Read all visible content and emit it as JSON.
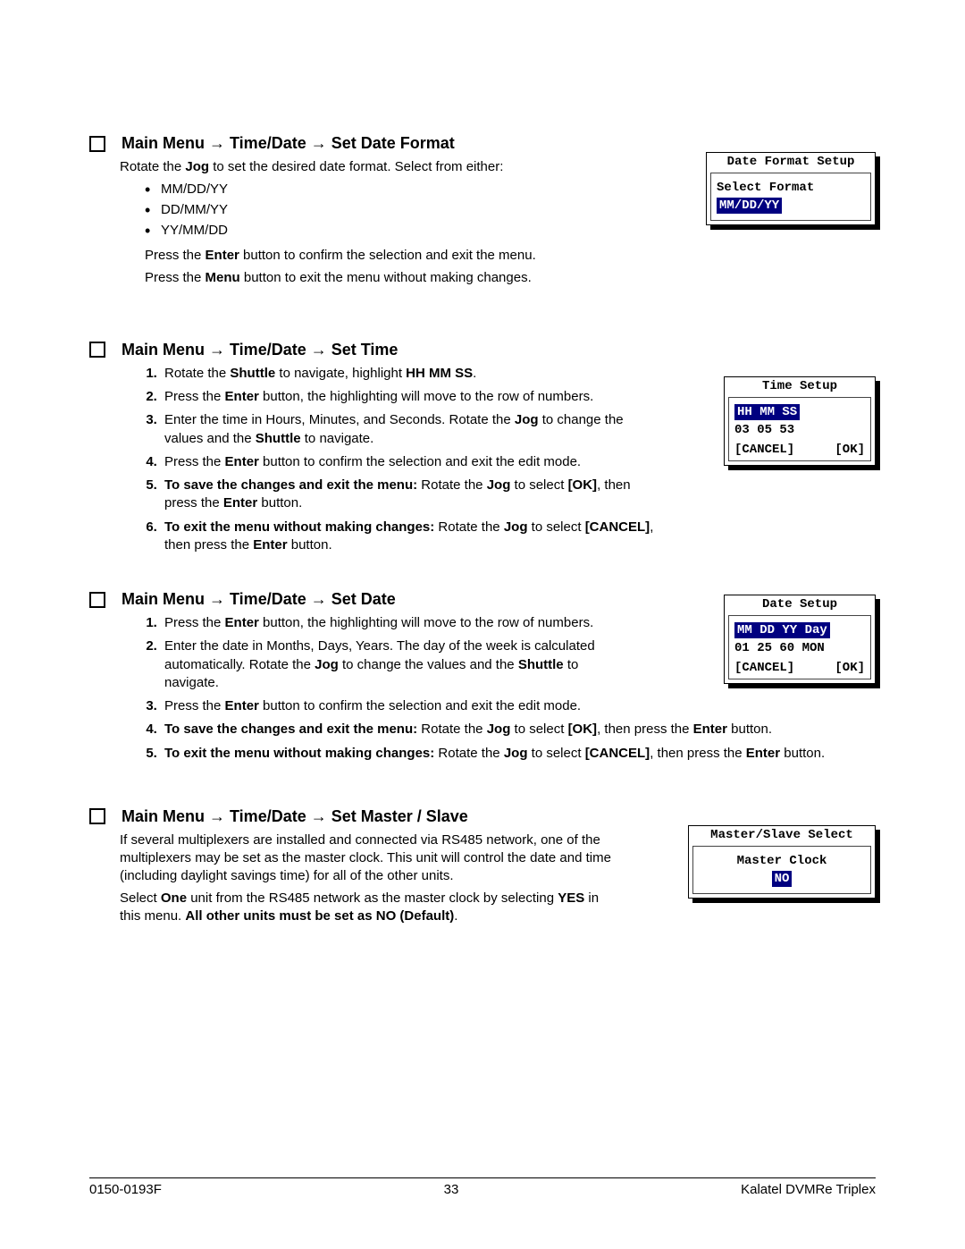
{
  "s1": {
    "heading_prefix": "Main Menu",
    "heading_mid": "Time/Date",
    "heading_end": "Set Date Format",
    "intro_a": "Rotate the ",
    "intro_b": "Jog",
    "intro_c": " to set the desired date format.  Select from either:",
    "opts": [
      "MM/DD/YY",
      "DD/MM/YY",
      "YY/MM/DD"
    ],
    "p1a": "Press the ",
    "p1b": "Enter",
    "p1c": " button to confirm the selection and exit the menu.",
    "p2a": "Press the ",
    "p2b": "Menu",
    "p2c": " button to exit the menu without making changes.",
    "ui": {
      "title": "Date Format Setup",
      "line1": "Select Format",
      "hl": "MM/DD/YY"
    }
  },
  "s2": {
    "heading_prefix": "Main Menu",
    "heading_mid": "Time/Date",
    "heading_end": "Set Time",
    "st1a": "Rotate the ",
    "st1b": "Shuttle",
    "st1c": " to navigate, highlight ",
    "st1d": "HH MM SS",
    "st1e": ".",
    "st2a": "Press the ",
    "st2b": "Enter",
    "st2c": " button, the highlighting will move to the row of numbers.",
    "st3a": "Enter the time in Hours, Minutes, and Seconds.  Rotate the ",
    "st3b": "Jog",
    "st3c": " to change the values and the ",
    "st3d": "Shuttle",
    "st3e": " to navigate.",
    "st4a": "Press the ",
    "st4b": "Enter",
    "st4c": " button to confirm the selection and exit the edit mode.",
    "st5a": "To save the changes and exit the menu:",
    "st5b": "  Rotate the ",
    "st5c": "Jog",
    "st5d": " to select ",
    "st5e": "[OK]",
    "st5f": ", then press the ",
    "st5g": "Enter",
    "st5h": " button.",
    "st6a": "To exit the menu without making changes:",
    "st6b": "  Rotate the ",
    "st6c": "Jog",
    "st6d": " to select ",
    "st6e": "[CANCEL]",
    "st6f": ", then press the ",
    "st6g": "Enter",
    "st6h": " button.",
    "ui": {
      "title": "Time Setup",
      "hl": "HH MM SS",
      "val": "03 05 53",
      "cancel": "[CANCEL]",
      "ok": "[OK]"
    }
  },
  "s3": {
    "heading_prefix": "Main Menu",
    "heading_mid": "Time/Date",
    "heading_end": "Set Date",
    "st1a": "Press the ",
    "st1b": "Enter",
    "st1c": " button, the highlighting will move to the row of numbers.",
    "st2a": "Enter the date in Months, Days, Years. The day of the week is calculated automatically. Rotate the ",
    "st2b": "Jog",
    "st2c": " to change the values and the ",
    "st2d": "Shuttle",
    "st2e": " to navigate.",
    "st3a": "Press the ",
    "st3b": "Enter",
    "st3c": " button to confirm the selection and exit the edit mode.",
    "st4a": "To save the changes and exit the menu:",
    "st4b": "  Rotate the ",
    "st4c": "Jog",
    "st4d": " to select ",
    "st4e": "[OK]",
    "st4f": ", then press the ",
    "st4g": "Enter",
    "st4h": " button.",
    "st5a": "To exit the menu without making changes:",
    "st5b": "  Rotate the ",
    "st5c": "Jog",
    "st5d": " to select ",
    "st5e": "[CANCEL]",
    "st5f": ", then press the ",
    "st5g": "Enter",
    "st5h": " button.",
    "ui": {
      "title": "Date Setup",
      "hl": "MM DD YY Day",
      "val": "01 25 60 MON",
      "cancel": "[CANCEL]",
      "ok": "[OK]"
    }
  },
  "s4": {
    "heading_prefix": "Main Menu",
    "heading_mid": "Time/Date",
    "heading_end": "Set Master / Slave",
    "p1": "If several multiplexers are installed and connected via RS485 network, one of the multiplexers may be set as the master clock.  This unit will control the date and time (including daylight savings time) for all of the other units.",
    "p2a": "Select ",
    "p2b": "One",
    "p2c": " unit from the RS485 network as the master clock by selecting ",
    "p2d": "YES",
    "p2e": " in this menu.  ",
    "p2f": "All other units must be set as NO (Default)",
    "p2g": ".",
    "ui": {
      "title": "Master/Slave Select",
      "line1": "Master Clock",
      "hl": "NO"
    }
  },
  "footer": {
    "left": "0150-0193F",
    "center": "33",
    "right": "Kalatel DVMRe Triplex"
  },
  "arrow": " → "
}
